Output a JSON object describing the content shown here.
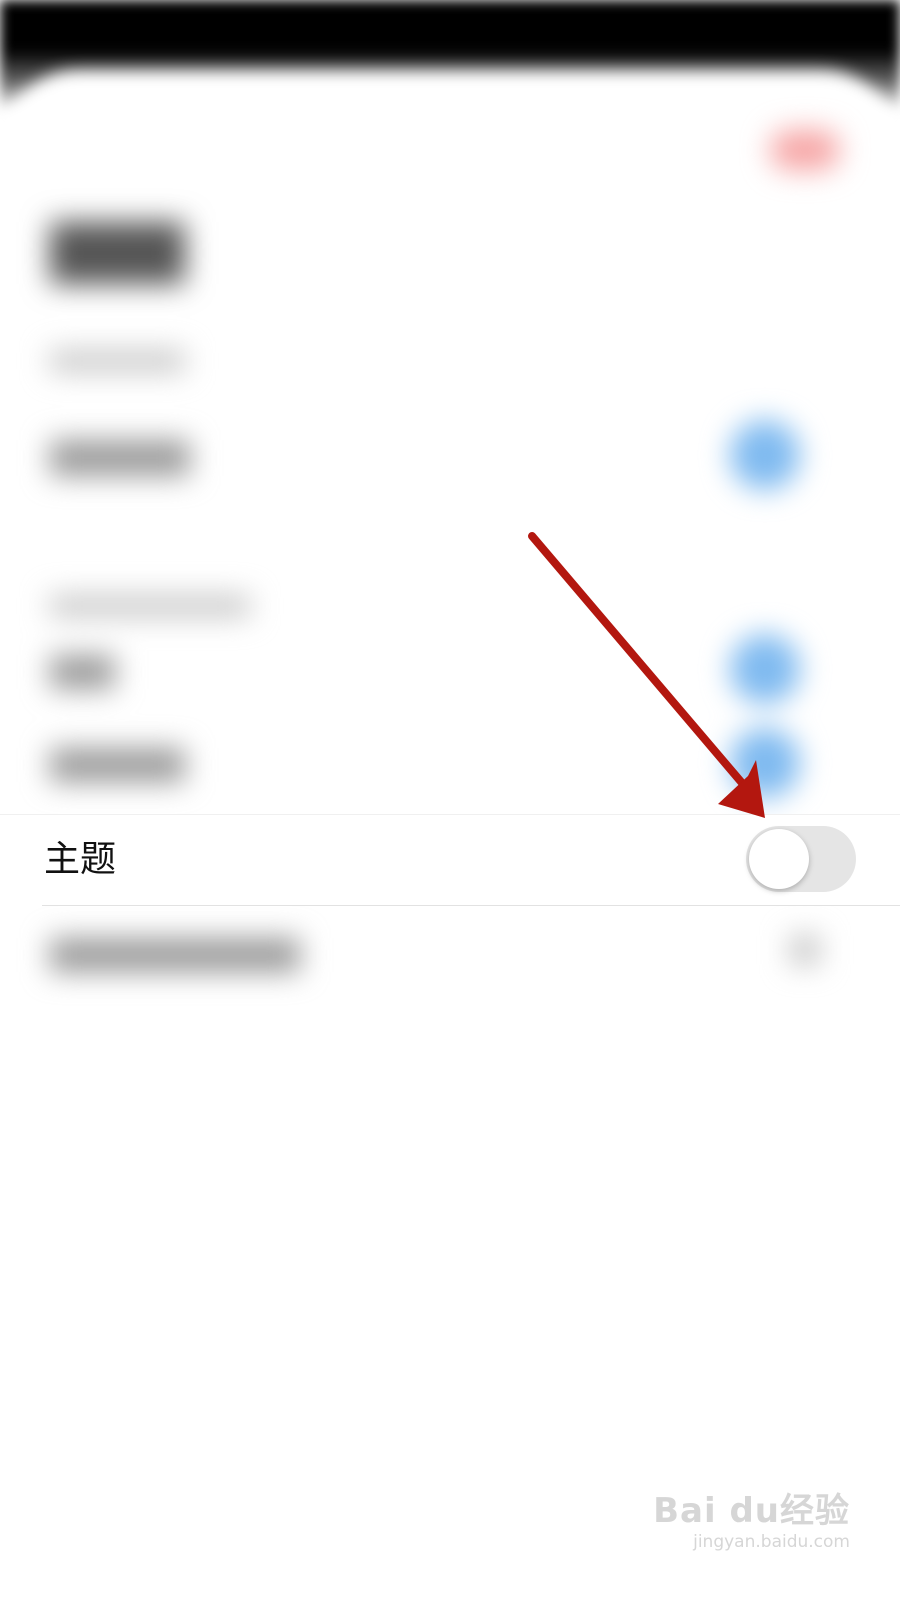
{
  "settings": {
    "theme_row": {
      "label": "主题",
      "toggle_on": false
    }
  },
  "watermark": {
    "brand": "Bai du经验",
    "site": "jingyan.baidu.com"
  },
  "colors": {
    "annotation_arrow": "#b3170f",
    "toggle_off_track": "#e5e5e5",
    "blurred_toggle_on": "#7fbaf0"
  }
}
